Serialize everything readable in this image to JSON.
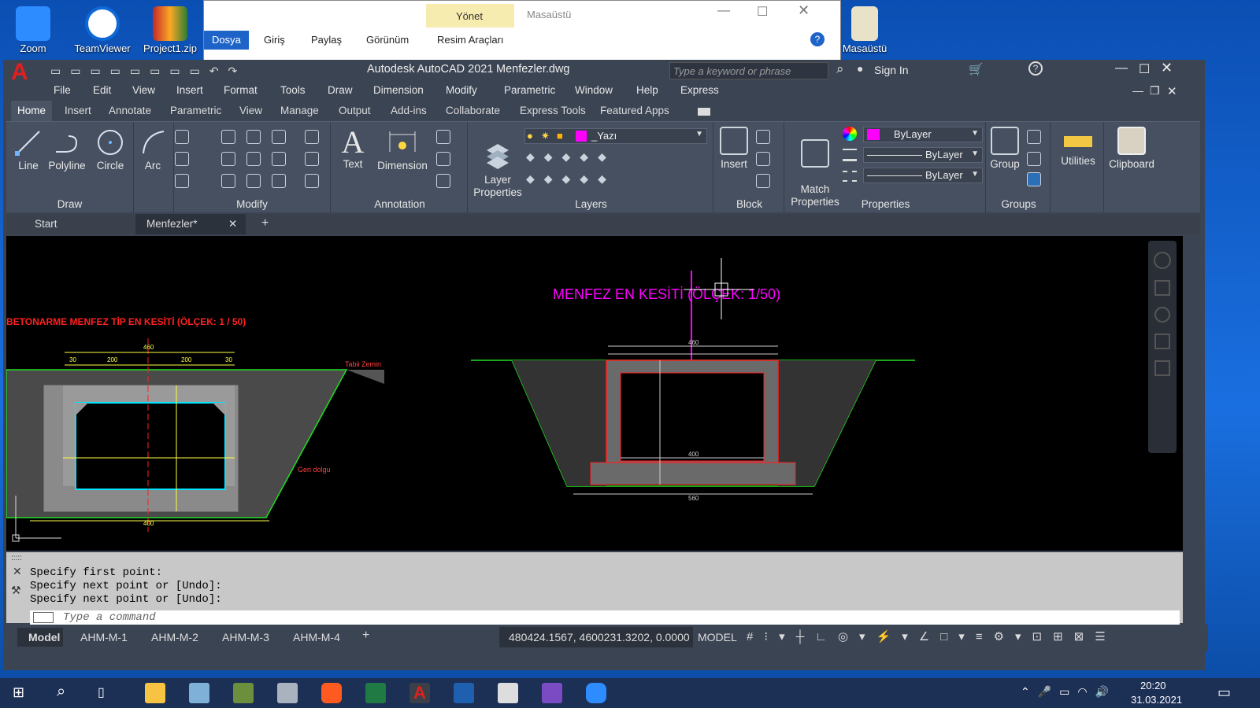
{
  "desktop": {
    "icons": [
      {
        "label": "Zoom"
      },
      {
        "label": "TeamViewer"
      },
      {
        "label": "Project1.zip"
      },
      {
        "label": "Masaüstü"
      }
    ]
  },
  "explorer": {
    "tabs": [
      "Dosya",
      "Giriş",
      "Paylaş",
      "Görünüm",
      "Resim Araçları"
    ],
    "manage_label": "Yönet",
    "location": "Masaüstü"
  },
  "acad": {
    "title": "Autodesk AutoCAD 2021",
    "file": "Menfezler.dwg",
    "search_placeholder": "Type a keyword or phrase",
    "sign_in": "Sign In",
    "menus": [
      "File",
      "Edit",
      "View",
      "Insert",
      "Format",
      "Tools",
      "Draw",
      "Dimension",
      "Modify",
      "Parametric",
      "Window",
      "Help",
      "Express"
    ],
    "ribbon_tabs": [
      "Home",
      "Insert",
      "Annotate",
      "Parametric",
      "View",
      "Manage",
      "Output",
      "Add-ins",
      "Collaborate",
      "Express Tools",
      "Featured Apps"
    ],
    "draw_tools": [
      "Line",
      "Polyline",
      "Circle",
      "Arc"
    ],
    "panels": {
      "draw": "Draw",
      "modify": "Modify",
      "annotation": "Annotation",
      "layers": "Layers",
      "block": "Block",
      "properties": "Properties",
      "groups": "Groups"
    },
    "annotation_tools": [
      "Text",
      "Dimension"
    ],
    "layer_properties": "Layer\nProperties",
    "current_layer": "_Yazı",
    "insert_label": "Insert",
    "match_properties": "Match\nProperties",
    "bylayer_color": "ByLayer",
    "bylayer_lineweight": "ByLayer",
    "bylayer_linetype": "ByLayer",
    "group_label": "Group",
    "utilities_label": "Utilities",
    "clipboard_label": "Clipboard",
    "doc_tabs": [
      "Start",
      "Menfezler*"
    ],
    "drawing": {
      "title_left": "BETONARME MENFEZ TİP EN KESİTİ (ÖLÇEK: 1 / 50)",
      "title_right": "MENFEZ EN KESİTİ (ÖLÇEK: 1/50)",
      "label_zemin": "Tabii Zemin",
      "label_dolgu": "Geri dolgu",
      "dims_top": [
        "30",
        "200",
        "200",
        "30"
      ],
      "dim_460": "460",
      "dim_400": "400",
      "dim_560": "560"
    },
    "command_history": [
      "Specify first point:",
      "Specify next point or [Undo]:",
      "Specify next point or [Undo]:"
    ],
    "command_placeholder": "Type a command",
    "layout_tabs": [
      "Model",
      "AHM-M-1",
      "AHM-M-2",
      "AHM-M-3",
      "AHM-M-4"
    ],
    "coords": "480424.1567, 4600231.3202, 0.0000",
    "space": "MODEL"
  },
  "taskbar": {
    "time": "20:20",
    "date": "31.03.2021"
  },
  "colors": {
    "magenta": "#ff00ff",
    "cyan": "#00e5ff",
    "red": "#ff2020",
    "green": "#22dd22",
    "yellow": "#ffff44",
    "gray": "#777777"
  }
}
